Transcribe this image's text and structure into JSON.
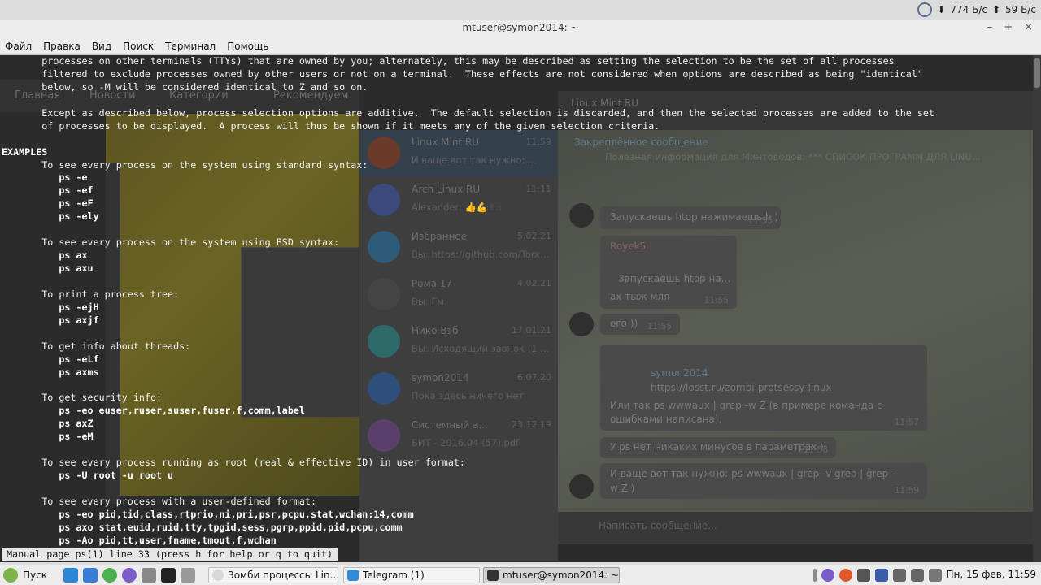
{
  "topbar": {
    "download_speed": "774 Б/с",
    "upload_speed": "59 Б/с"
  },
  "window": {
    "title": "mtuser@symon2014: ~",
    "controls": [
      "–",
      "+",
      "×"
    ]
  },
  "menubar": [
    "Файл",
    "Правка",
    "Вид",
    "Поиск",
    "Терминал",
    "Помощь"
  ],
  "terminal": {
    "lines": [
      {
        "text": "       processes on other terminals (TTYs) that are owned by you; alternately, this may be described as setting the selection to be the set of all processes",
        "bold": false
      },
      {
        "text": "       filtered to exclude processes owned by other users or not on a terminal.  These effects are not considered when options are described as being \"identical\"",
        "bold": false
      },
      {
        "text": "       below, so -M will be considered identical to Z and so on.",
        "bold": false
      },
      {
        "text": "",
        "bold": false
      },
      {
        "text": "       Except as described below, process selection options are additive.  The default selection is discarded, and then the selected processes are added to the set",
        "bold": false
      },
      {
        "text": "       of processes to be displayed.  A process will thus be shown if it meets any of the given selection criteria.",
        "bold": false
      },
      {
        "text": "",
        "bold": false
      },
      {
        "text": "EXAMPLES",
        "bold": true
      },
      {
        "text": "       To see every process on the system using standard syntax:",
        "bold": false
      },
      {
        "text": "          ps -e",
        "bold": true
      },
      {
        "text": "          ps -ef",
        "bold": true
      },
      {
        "text": "          ps -eF",
        "bold": true
      },
      {
        "text": "          ps -ely",
        "bold": true
      },
      {
        "text": "",
        "bold": false
      },
      {
        "text": "       To see every process on the system using BSD syntax:",
        "bold": false
      },
      {
        "text": "          ps ax",
        "bold": true
      },
      {
        "text": "          ps axu",
        "bold": true
      },
      {
        "text": "",
        "bold": false
      },
      {
        "text": "       To print a process tree:",
        "bold": false
      },
      {
        "text": "          ps -ejH",
        "bold": true
      },
      {
        "text": "          ps axjf",
        "bold": true
      },
      {
        "text": "",
        "bold": false
      },
      {
        "text": "       To get info about threads:",
        "bold": false
      },
      {
        "text": "          ps -eLf",
        "bold": true
      },
      {
        "text": "          ps axms",
        "bold": true
      },
      {
        "text": "",
        "bold": false
      },
      {
        "text": "       To get security info:",
        "bold": false
      },
      {
        "text": "          ps -eo euser,ruser,suser,fuser,f,comm,label",
        "bold": true
      },
      {
        "text": "          ps axZ",
        "bold": true
      },
      {
        "text": "          ps -eM",
        "bold": true
      },
      {
        "text": "",
        "bold": false
      },
      {
        "text": "       To see every process running as root (real & effective ID) in user format:",
        "bold": false
      },
      {
        "text": "          ps -U root -u root u",
        "bold": true
      },
      {
        "text": "",
        "bold": false
      },
      {
        "text": "       To see every process with a user-defined format:",
        "bold": false
      },
      {
        "text": "          ps -eo pid,tid,class,rtprio,ni,pri,psr,pcpu,stat,wchan:14,comm",
        "bold": true
      },
      {
        "text": "          ps axo stat,euid,ruid,tty,tpgid,sess,pgrp,ppid,pid,pcpu,comm",
        "bold": true
      },
      {
        "text": "          ps -Ao pid,tt,user,fname,tmout,f,wchan",
        "bold": true
      }
    ],
    "status": "Manual page ps(1) line 33 (press h for help or q to quit)"
  },
  "background": {
    "tabs": [
      "Главная",
      "Новости",
      "Категории",
      "Рекомендуем"
    ],
    "chat_header": "Linux Mint RU",
    "pinned_title": "Закреплённое сообщение",
    "pinned_text": "Полезная информация для Минтоводов: *** СПИСОК ПРОГРАММ ДЛЯ LINU...",
    "chats": [
      {
        "name": "Linux Mint RU",
        "preview": "И ваще вот так нужно: ...",
        "date": "11:59",
        "color": "#6b3a2a"
      },
      {
        "name": "Arch Linux RU",
        "preview": "Alexander: 👍💪✌☝",
        "date": "11:11",
        "color": "#3b4a7a"
      },
      {
        "name": "Избранное",
        "preview": "Вы: https://github.com/Torx...",
        "date": "5.02.21",
        "color": "#2f5a7a"
      },
      {
        "name": "Рома 17",
        "preview": "Вы: Гм",
        "date": "4.02.21",
        "color": "#444444"
      },
      {
        "name": "Нико Вэб",
        "preview": "Вы: Исходящий звонок (1 ...",
        "date": "17.01.21",
        "color": "#2f6a6a"
      },
      {
        "name": "symon2014",
        "preview": "Пока здесь ничего нет",
        "date": "6.07.20",
        "color": "#2f4f7a"
      },
      {
        "name": "Системный а...",
        "preview": "БИТ - 2016.04 (57).pdf",
        "date": "23.12.19",
        "color": "#5a3f6a"
      }
    ],
    "messages": [
      {
        "text": "Запускаешь htop нажимаешь h )",
        "time": "11:55"
      },
      {
        "text": "Royek5",
        "time": ""
      },
      {
        "text": "Запускаешь htop на...",
        "time": ""
      },
      {
        "text": "ах тыж мля",
        "time": "11:55"
      },
      {
        "text": "ого ))",
        "time": "11:55"
      },
      {
        "text": "symon2014",
        "time": ""
      },
      {
        "text": "https://losst.ru/zombi-protsessy-linux",
        "time": ""
      },
      {
        "text": "Или так ps wwwaux | grep -w Z (в примере команда с",
        "time": ""
      },
      {
        "text": "ошибками написана).",
        "time": "11:57"
      },
      {
        "text": "У ps нет никаких минусов в параметрах )",
        "time": "11:58"
      },
      {
        "text": "И ваще вот так нужно: ps wwwaux | grep -v grep | grep -",
        "time": ""
      },
      {
        "text": "w Z )",
        "time": "11:59"
      }
    ],
    "input_placeholder": "Написать сообщение..."
  },
  "taskbar": {
    "start_label": "Пуск",
    "tasks": [
      {
        "label": "Зомби процессы Lin...",
        "color": "#d9d9d9"
      },
      {
        "label": "Telegram (1)",
        "color": "#2f8ad8"
      },
      {
        "label": "mtuser@symon2014: ~",
        "color": "#333333"
      }
    ],
    "clock": "Пн, 15 фев, 11:59"
  }
}
